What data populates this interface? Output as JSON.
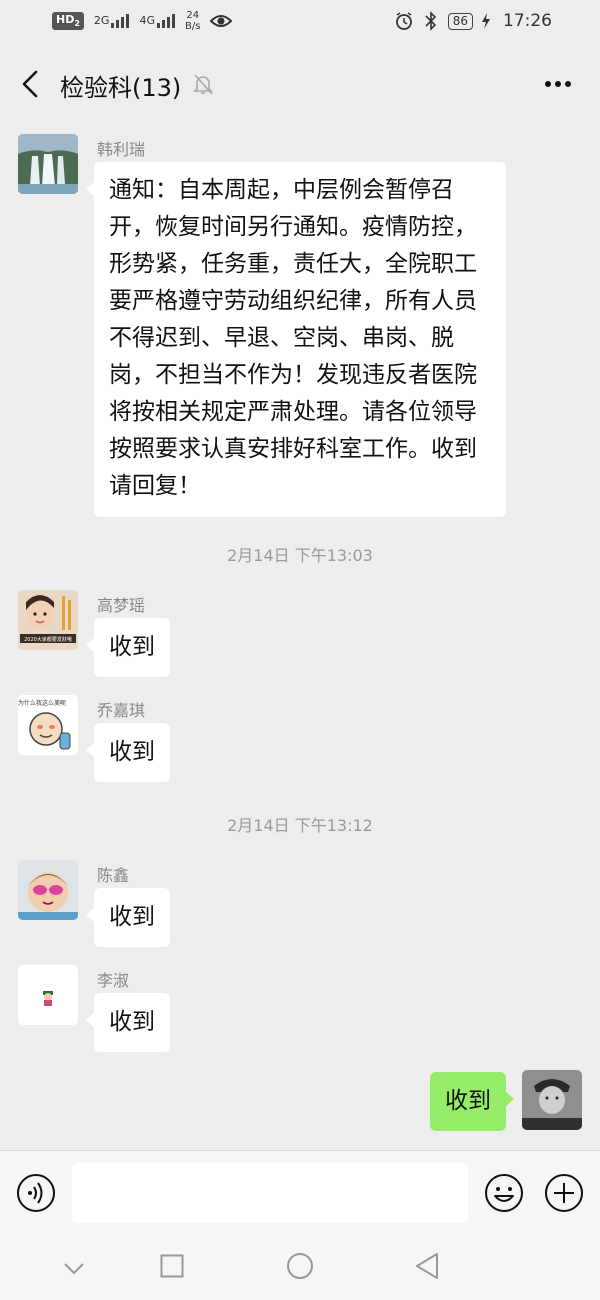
{
  "status_bar": {
    "hd": "HD",
    "hd_sub": "2",
    "net1": "2G",
    "net2": "4G",
    "speed_value": "24",
    "speed_unit": "B/s",
    "battery": "86",
    "time": "17:26"
  },
  "header": {
    "title": "检验科(13)"
  },
  "messages": [
    {
      "sender": "韩利瑞",
      "text": "通知：自本周起，中层例会暂停召开，恢复时间另行通知。疫情防控，形势紧，任务重，责任大，全院职工要严格遵守劳动组织纪律，所有人员不得迟到、早退、空岗、串岗、脱岗，不担当不作为！发现违反者医院将按相关规定严肃处理。请各位领导按照要求认真安排好科室工作。收到请回复！"
    },
    {
      "sender": "高梦瑶",
      "text": "收到",
      "avatar_caption": "2020大家都要发财哦"
    },
    {
      "sender": "乔嘉琪",
      "text": "收到",
      "avatar_caption": "为什么我这么美呢"
    },
    {
      "sender": "陈鑫",
      "text": "收到"
    },
    {
      "sender": "李淑",
      "text": "收到"
    }
  ],
  "timestamps": [
    "2月14日 下午13:03",
    "2月14日 下午13:12"
  ],
  "my_message": {
    "text": "收到"
  },
  "colors": {
    "background": "#ededed",
    "my_bubble": "#95ec69",
    "other_bubble": "#ffffff"
  },
  "icons": {
    "back": "chevron-left-icon",
    "mute": "bell-slash-icon",
    "more": "ellipsis-icon",
    "voice": "voice-icon",
    "emoji": "smiley-icon",
    "plus": "plus-circle-icon"
  }
}
